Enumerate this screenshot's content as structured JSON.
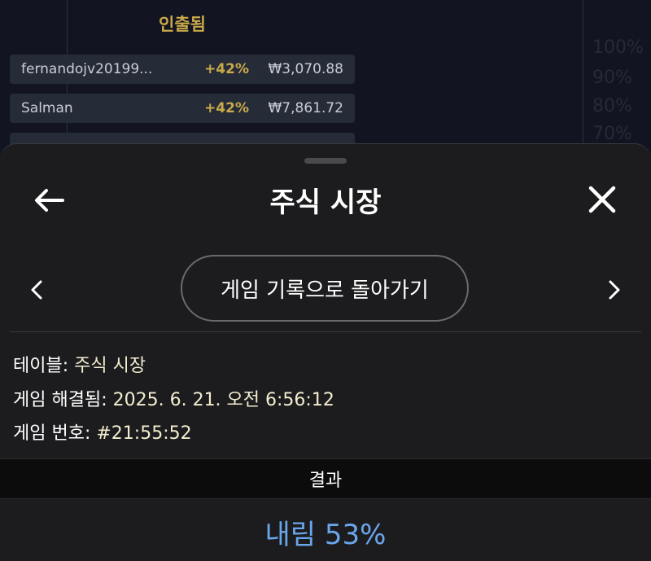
{
  "background": {
    "title": "인출됨",
    "rows": [
      {
        "name": "fernandojv20199...",
        "pct": "+42%",
        "amount": "₩3,070.88"
      },
      {
        "name": "Salman",
        "pct": "+42%",
        "amount": "₩7,861.72"
      }
    ],
    "axis_labels": [
      "100%",
      "90%",
      "80%",
      "70%"
    ]
  },
  "header": {
    "title": "주식 시장"
  },
  "history_button_label": "게임 기록으로 돌아가기",
  "info": {
    "table_label": "테이블:",
    "table_value": "주식 시장",
    "resolved_label": "게임 해결됨:",
    "resolved_value": "2025. 6. 21. 오전 6:56:12",
    "game_no_label": "게임 번호:",
    "game_no_value": "#21:55:52"
  },
  "result": {
    "header": "결과",
    "value": "내림 53%",
    "color": "#6aa6ea"
  },
  "icons": [
    "back-arrow-icon",
    "close-icon",
    "chevron-left-icon",
    "chevron-right-icon"
  ]
}
